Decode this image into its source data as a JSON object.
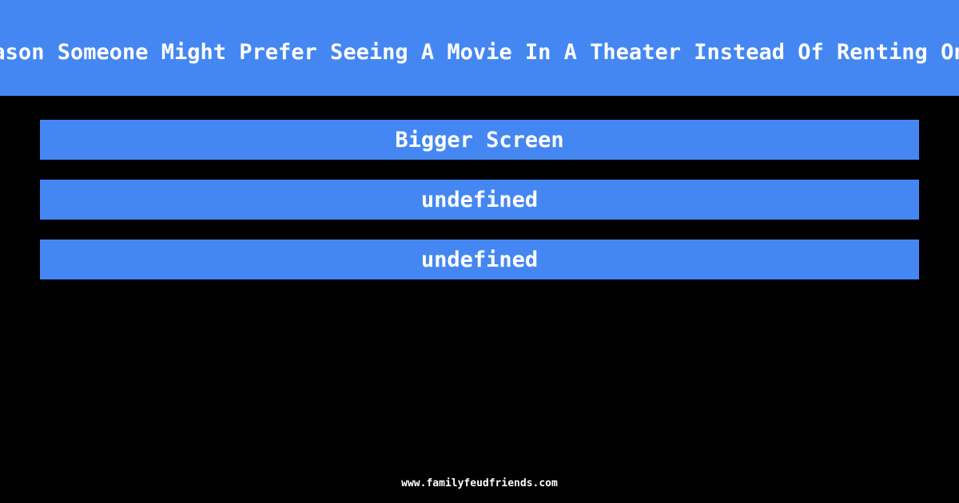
{
  "header": {
    "question_visible": "ason Someone Might Prefer Seeing A Movie In A Theater Instead Of Renting On"
  },
  "answers": [
    {
      "label": "Bigger Screen"
    },
    {
      "label": "undefined"
    },
    {
      "label": "undefined"
    }
  ],
  "footer": {
    "url": "www.familyfeudfriends.com"
  },
  "colors": {
    "accent": "#4487f2",
    "background": "#000000",
    "text": "#ffffff"
  }
}
